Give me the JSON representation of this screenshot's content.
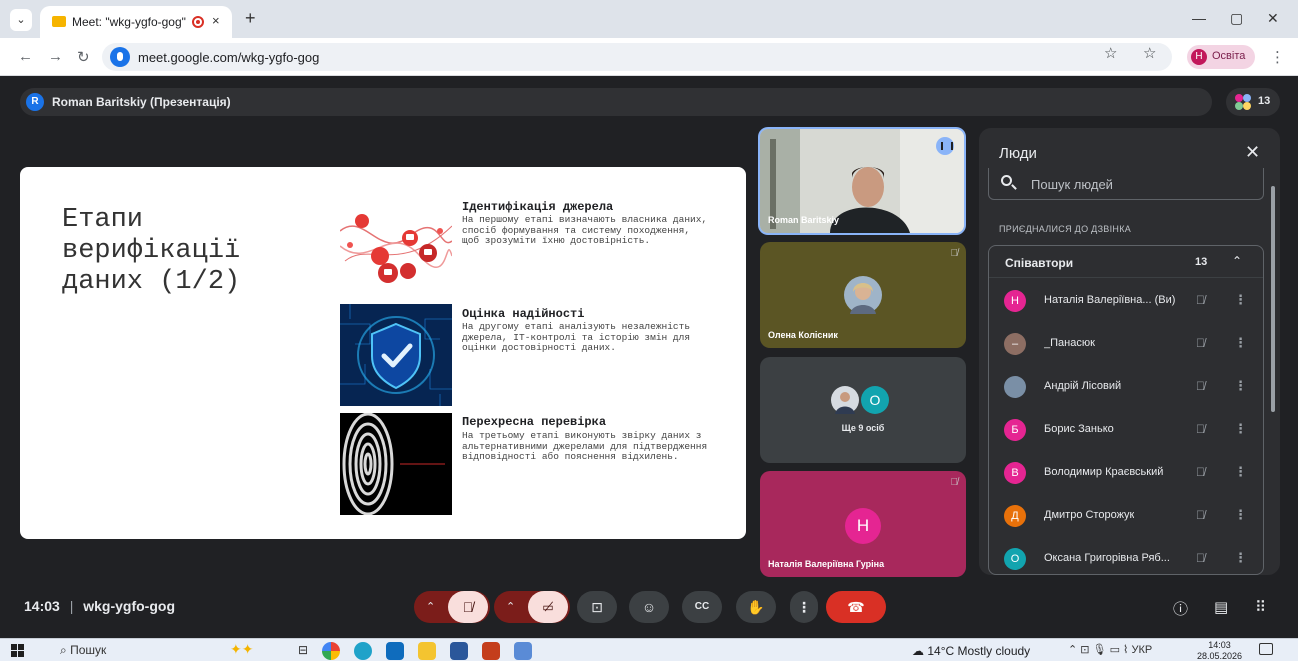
{
  "browser": {
    "tab_title": "Meet: \"wkg-ygfo-gog\"",
    "tab_close": "×",
    "new_tab": "+",
    "url": "meet.google.com/wkg-ygfo-gog",
    "profile_initial": "Н",
    "profile_name": "Освіта",
    "minimize": "—",
    "maximize": "▢",
    "close": "✕"
  },
  "meet": {
    "presenter_initial": "R",
    "presenter_label": "Roman Baritskiy (Презентація)",
    "participant_count": "13",
    "meeting_time": "14:03",
    "meeting_code": "wkg-ygfo-gog"
  },
  "slide": {
    "title": "Етапи\nверифікації\nданих (1/2)",
    "steps": [
      {
        "title": "Ідентифікація джерела",
        "text": "На першому етапі визначають власника даних, спосіб формування та систему походження, щоб зрозуміти їхню достовірність."
      },
      {
        "title": "Оцінка надійності",
        "text": "На другому етапі аналізують незалежність джерела, ІТ-контролі та історію змін для оцінки достовірності даних."
      },
      {
        "title": "Перехресна перевірка",
        "text": "На третьому етапі виконують звірку даних з альтернативними джерелами для підтвердження відповідності або пояснення відхилень."
      }
    ]
  },
  "tiles": {
    "roman": "Roman Baritskiy",
    "olena": "Олена Колісник",
    "more_label": "Ще 9 осіб",
    "more_initial": "О",
    "natalia_initial": "Н",
    "natalia": "Наталія Валеріївна Гуріна"
  },
  "people_panel": {
    "title": "Люди",
    "search_placeholder": "Пошук людей",
    "joined_label": "ПРИЄДНАЛИСЯ ДО ДЗВІНКА",
    "group_label": "Співавтори",
    "group_count": "13",
    "people": [
      {
        "initial": "Н",
        "name": "Наталія Валеріївна... (Ви)",
        "color": "#e52592"
      },
      {
        "initial": "–",
        "name": "_Панасюк",
        "color": "#8d6e63"
      },
      {
        "initial": "",
        "name": "Андрій Лісовий",
        "color": "#7a8fa6"
      },
      {
        "initial": "Б",
        "name": "Борис Занько",
        "color": "#e52592"
      },
      {
        "initial": "В",
        "name": "Володимир Краєвський",
        "color": "#e52592"
      },
      {
        "initial": "Д",
        "name": "Дмитро Сторожук",
        "color": "#e8710a"
      },
      {
        "initial": "О",
        "name": "Оксана Григорівна Ряб...",
        "color": "#12a4af"
      }
    ]
  },
  "taskbar": {
    "search": "Пошук",
    "weather": "14°C  Mostly cloudy",
    "lang": "УКР",
    "time": "14:03",
    "date": "28.05.2026"
  }
}
